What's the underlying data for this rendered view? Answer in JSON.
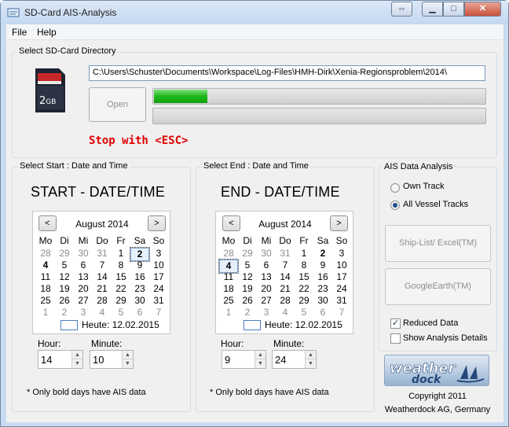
{
  "window": {
    "title": "SD-Card AIS-Analysis"
  },
  "menu": [
    "File",
    "Help"
  ],
  "dir_group": {
    "label": "Select SD-Card Directory",
    "card_label": "2GB",
    "path": "C:\\Users\\Schuster\\Documents\\Workspace\\Log-Files\\HMH-Dirk\\Xenia-Regionsproblem\\2014\\",
    "open_label": "Open",
    "progress_fraction": 0.16,
    "stop_text": "Stop  with <ESC>",
    "stop_color": "#e00000"
  },
  "weekday_headers": [
    "Mo",
    "Di",
    "Mi",
    "Do",
    "Fr",
    "Sa",
    "So"
  ],
  "calendar_rows": [
    [
      [
        "28",
        "o"
      ],
      [
        "29",
        "o"
      ],
      [
        "30",
        "o"
      ],
      [
        "31",
        "o"
      ],
      [
        "1",
        ""
      ],
      [
        "2",
        "sel"
      ],
      [
        "3",
        ""
      ]
    ],
    [
      [
        "4",
        "b"
      ],
      [
        "5",
        ""
      ],
      [
        "6",
        ""
      ],
      [
        "7",
        ""
      ],
      [
        "8",
        ""
      ],
      [
        "9",
        ""
      ],
      [
        "10",
        ""
      ]
    ],
    [
      [
        "11",
        ""
      ],
      [
        "12",
        ""
      ],
      [
        "13",
        ""
      ],
      [
        "14",
        ""
      ],
      [
        "15",
        ""
      ],
      [
        "16",
        ""
      ],
      [
        "17",
        ""
      ]
    ],
    [
      [
        "18",
        ""
      ],
      [
        "19",
        ""
      ],
      [
        "20",
        ""
      ],
      [
        "21",
        ""
      ],
      [
        "22",
        ""
      ],
      [
        "23",
        ""
      ],
      [
        "24",
        ""
      ]
    ],
    [
      [
        "25",
        ""
      ],
      [
        "26",
        ""
      ],
      [
        "27",
        ""
      ],
      [
        "28",
        ""
      ],
      [
        "29",
        ""
      ],
      [
        "30",
        ""
      ],
      [
        "31",
        ""
      ]
    ],
    [
      [
        "1",
        "o"
      ],
      [
        "2",
        "o"
      ],
      [
        "3",
        "o"
      ],
      [
        "4",
        "o"
      ],
      [
        "5",
        "o"
      ],
      [
        "6",
        "o"
      ],
      [
        "7",
        "o"
      ]
    ]
  ],
  "calendar_rows_end": [
    [
      [
        "28",
        "o"
      ],
      [
        "29",
        "o"
      ],
      [
        "30",
        "o"
      ],
      [
        "31",
        "o"
      ],
      [
        "1",
        ""
      ],
      [
        "2",
        "b"
      ],
      [
        "3",
        ""
      ]
    ],
    [
      [
        "4",
        "sel"
      ],
      [
        "5",
        ""
      ],
      [
        "6",
        ""
      ],
      [
        "7",
        ""
      ],
      [
        "8",
        ""
      ],
      [
        "9",
        ""
      ],
      [
        "10",
        ""
      ]
    ],
    [
      [
        "11",
        ""
      ],
      [
        "12",
        ""
      ],
      [
        "13",
        ""
      ],
      [
        "14",
        ""
      ],
      [
        "15",
        ""
      ],
      [
        "16",
        ""
      ],
      [
        "17",
        ""
      ]
    ],
    [
      [
        "18",
        ""
      ],
      [
        "19",
        ""
      ],
      [
        "20",
        ""
      ],
      [
        "21",
        ""
      ],
      [
        "22",
        ""
      ],
      [
        "23",
        ""
      ],
      [
        "24",
        ""
      ]
    ],
    [
      [
        "25",
        ""
      ],
      [
        "26",
        ""
      ],
      [
        "27",
        ""
      ],
      [
        "28",
        ""
      ],
      [
        "29",
        ""
      ],
      [
        "30",
        ""
      ],
      [
        "31",
        ""
      ]
    ],
    [
      [
        "1",
        "o"
      ],
      [
        "2",
        "o"
      ],
      [
        "3",
        "o"
      ],
      [
        "4",
        "o"
      ],
      [
        "5",
        "o"
      ],
      [
        "6",
        "o"
      ],
      [
        "7",
        "o"
      ]
    ]
  ],
  "start": {
    "group_label": "Select Start : Date and Time",
    "title": "START - DATE/TIME",
    "month": "August 2014",
    "today": "Heute: 12.02.2015",
    "hour_label": "Hour:",
    "hour": "14",
    "minute_label": "Minute:",
    "minute": "10",
    "note": "* Only bold days have AIS data"
  },
  "end": {
    "group_label": "Select End : Date and Time",
    "title": "END - DATE/TIME",
    "month": "August 2014",
    "today": "Heute: 12.02.2015",
    "hour_label": "Hour:",
    "hour": "9",
    "minute_label": "Minute:",
    "minute": "24",
    "note": "* Only bold days have AIS data"
  },
  "ais": {
    "group_label": "AIS Data Analysis",
    "radio_own": "Own Track",
    "radio_all": "All Vessel Tracks",
    "btn_ship": "Ship-List/ Excel(TM)",
    "btn_google": "GoogleEarth(TM)",
    "chk_reduced": "Reduced Data",
    "chk_details": "Show Analysis Details",
    "reduced_checked": true,
    "details_checked": false,
    "logo_text": "weatherdock",
    "copyright": "Copyright 2011",
    "company": "Weatherdock AG, Germany"
  },
  "glyphs": {
    "prev": "<",
    "next": ">",
    "up": "▲",
    "down": "▼",
    "check": "✓"
  }
}
